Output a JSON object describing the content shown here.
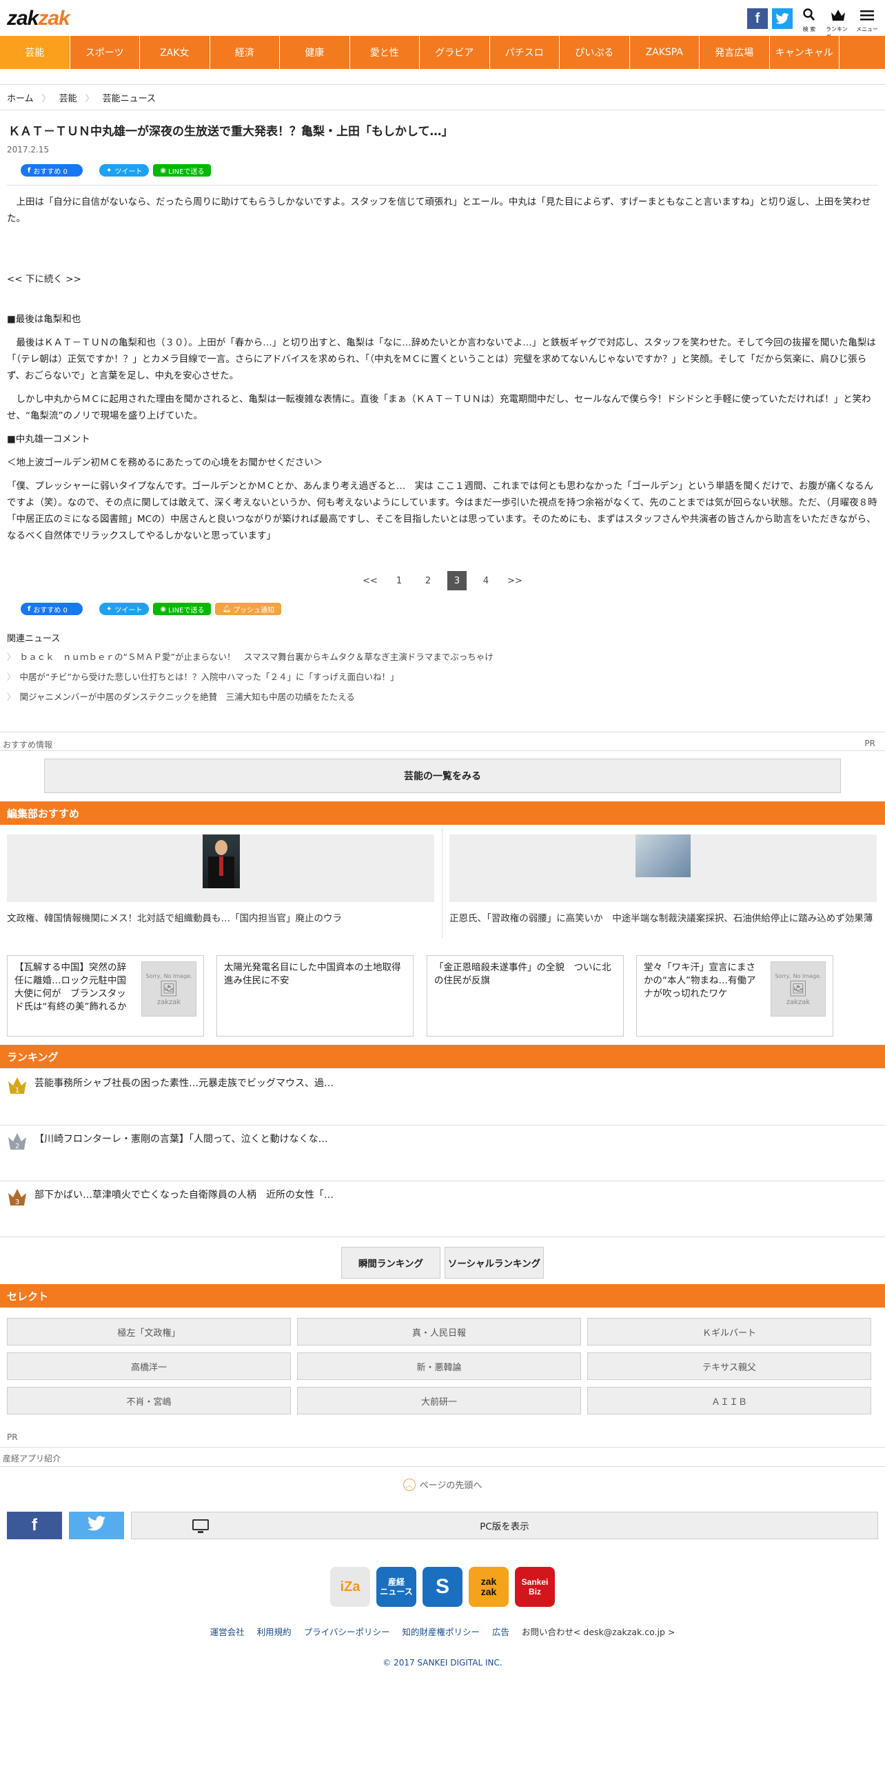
{
  "header": {
    "logo_a": "zak",
    "logo_b": "zak",
    "search_label": "検 索",
    "ranking_label": "ランキング",
    "menu_label": "メニュー"
  },
  "nav": [
    "芸能",
    "スポーツ",
    "ZAK女",
    "経済",
    "健康",
    "愛と性",
    "グラビア",
    "パチスロ",
    "ぴいぷる",
    "ZAKSPA",
    "発言広場",
    "キャンキャル"
  ],
  "breadcrumb": [
    "ホーム",
    "芸能",
    "芸能ニュース"
  ],
  "article": {
    "title": "ＫＡＴ－ＴＵＮ中丸雄一が深夜の生放送で重大発表！？亀梨・上田「もしかして…」",
    "date": "2017.2.15",
    "paragraphs": [
      "上田は「自分に自信がないなら、だったら周りに助けてもらうしかないですよ。スタッフを信じて頑張れ」とエール。中丸は「見た目によらず、すげーまともなこと言いますね」と切り返し、上田を笑わせた。",
      "<< 下に続く >>",
      "■最後は亀梨和也",
      "最後はＫＡＴ－ＴＵＮの亀梨和也（３０）。上田が「春から…」と切り出すと、亀梨は「なに…辞めたいとか言わないでよ…」と鉄板ギャグで対応し、スタッフを笑わせた。そして今回の抜擢を聞いた亀梨は「（テレ朝は）正気ですか！？」とカメラ目線で一言。さらにアドバイスを求められ、「（中丸をＭＣに置くということは）完璧を求めてないんじゃないですか？」と笑顔。そして「だから気楽に、肩ひじ張らず、おごらないで」と言葉を足し、中丸を安心させた。",
      "しかし中丸からＭＣに起用された理由を聞かされると、亀梨は一転複雑な表情に。直後「まぁ（ＫＡＴ－ＴＵＮは）充電期間中だし、セールなんで僕ら今！ドシドシと手軽に使っていただければ！」と笑わせ、“亀梨流”のノリで現場を盛り上げていた。",
      "■中丸雄一コメント",
      "＜地上波ゴールデン初ＭＣを務めるにあたっての心境をお聞かせください＞",
      "「僕、プレッシャーに弱いタイプなんです。ゴールデンとかＭＣとか、あんまり考え過ぎると…　実は ここ１週間、これまでは何とも思わなかった「ゴールデン」という単語を聞くだけで、お腹が痛くなるんですよ（笑）。なので、その点に関しては敢えて、深く考えないというか、何も考えないようにしています。今はまだ一歩引いた視点を持つ余裕がなくて、先のことまでは気が回らない状態。ただ、（月曜夜８時「中居正広のミになる図書館」MCの）中居さんと良いつながりが築ければ最高ですし、そこを目指したいとは思っています。そのためにも、まずはスタッフさんや共演者の皆さんから助言をいただきながら、なるべく自然体でリラックスしてやるしかないと思っています」"
    ],
    "share": {
      "fb": "おすすめ 0",
      "tw": "ツイート",
      "line": "LINEで送る",
      "push": "プッシュ通知"
    }
  },
  "pager": {
    "items": [
      "<<",
      "1",
      "2",
      "3",
      "4",
      ">>"
    ],
    "current": "3"
  },
  "related": {
    "title": "関連ニュース",
    "items": [
      "ｂａｃｋ　ｎｕｍｂｅｒの“ＳＭＡＰ愛”が止まらない！　スマスマ舞台裏からキムタク＆草なぎ主演ドラマまでぶっちゃけ",
      "中居が“チビ”から受けた悲しい仕打ちとは！？入院中ハマった「２４」に「すっげえ面白いね！」",
      "関ジャニメンバーが中居のダンステクニックを絶賛　三浦大知も中居の功績をたたえる"
    ]
  },
  "recommend_info": "おすすめ情報",
  "pr": "PR",
  "list_button": "芸能の一覧をみる",
  "editors": {
    "title": "編集部おすすめ",
    "features": [
      "文政権、韓国情報機関にメス！北対話で組織動員も…「国内担当官」廃止のウラ",
      "正恩氏、「習政権の弱腰」に高笑いか　中途半端な制裁決議案採択、石油供給停止に踏み込めず効果薄"
    ],
    "cards": [
      "【瓦解する中国】突然の辞任に離婚…ロック元駐中国大使に何が　ブランスタッド氏は“有終の美”飾れるか",
      "太陽光発電名目にした中国資本の土地取得進み住民に不安",
      "「金正恩暗殺未遂事件」の全貌　ついに北の住民が反旗",
      "堂々「ワキ汗」宣言にまさかの“本人”物まね…有働アナが吹っ切れたワケ"
    ],
    "no_image_text": "Sorry, No Image.",
    "no_image_brand": "zakzak"
  },
  "ranking": {
    "title": "ランキング",
    "items": [
      {
        "rank": "1",
        "text": "芸能事務所シャブ社長の困った素性…元暴走族でビッグマウス、過…"
      },
      {
        "rank": "2",
        "text": "【川崎フロンターレ・憲剛の言葉】「人間って、泣くと動けなくな…"
      },
      {
        "rank": "3",
        "text": "部下かばい…草津噴火で亡くなった自衛隊員の人柄　近所の女性「…"
      }
    ],
    "buttons": [
      "瞬間ランキング",
      "ソーシャルランキング"
    ]
  },
  "select": {
    "title": "セレクト",
    "items": [
      "極左「文政権」",
      "真・人民日報",
      "Ｋギルバート",
      "高橋洋一",
      "新・悪韓論",
      "テキサス親父",
      "不肖・宮嶋",
      "大前研一",
      "ＡＩＩＢ"
    ]
  },
  "pr2": "PR",
  "app_intro": "産経アプリ紹介",
  "to_top": "ページの先頭へ",
  "pc_view": "PC版を表示",
  "app_logos": [
    {
      "label": "iZa",
      "bg": "#e8e8e8",
      "fg": "#f09a1a"
    },
    {
      "label": "産経\nニュース",
      "bg": "#1a6fc0",
      "fg": "#ffffff"
    },
    {
      "label": "S",
      "bg": "#1a6fc0",
      "fg": "#ffffff"
    },
    {
      "label": "zak\nzak",
      "bg": "#f4a31a",
      "fg": "#111111"
    },
    {
      "label": "Sankei\nBiz",
      "bg": "#d3161c",
      "fg": "#ffffff"
    }
  ],
  "footer": {
    "links": [
      "運営会社",
      "利用規約",
      "プライバシーポリシー",
      "知的財産権ポリシー",
      "広告"
    ],
    "contact": "お問い合わせ< desk@zakzak.co.jp >",
    "copyright": "© 2017 SANKEI DIGITAL INC."
  },
  "colors": {
    "brand_orange": "#f47a20",
    "nav_active": "#fba01d",
    "facebook": "#3b5998",
    "twitter": "#1da1f2",
    "line": "#00b900"
  }
}
